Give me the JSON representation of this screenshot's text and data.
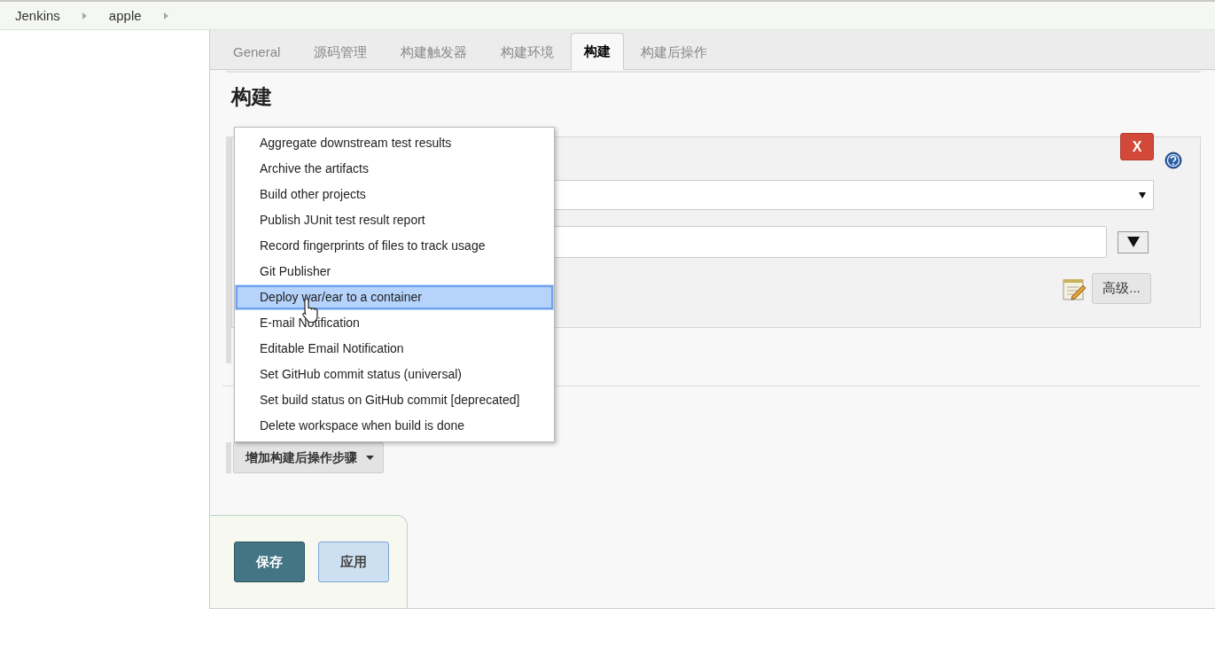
{
  "breadcrumbs": [
    {
      "label": "Jenkins"
    },
    {
      "label": "apple"
    }
  ],
  "tabs": [
    {
      "label": "General",
      "selected": false
    },
    {
      "label": "源码管理",
      "selected": false
    },
    {
      "label": "构建触发器",
      "selected": false
    },
    {
      "label": "构建环境",
      "selected": false
    },
    {
      "label": "构建",
      "selected": true
    },
    {
      "label": "构建后操作",
      "selected": false
    }
  ],
  "section_title": "构建",
  "build_step": {
    "delete_label": "X",
    "advanced_button": "高级..."
  },
  "add_post_build_button": "增加构建后操作步骤",
  "dropdown_menu": [
    {
      "label": "Aggregate downstream test results",
      "selected": false
    },
    {
      "label": "Archive the artifacts",
      "selected": false
    },
    {
      "label": "Build other projects",
      "selected": false
    },
    {
      "label": "Publish JUnit test result report",
      "selected": false
    },
    {
      "label": "Record fingerprints of files to track usage",
      "selected": false
    },
    {
      "label": "Git Publisher",
      "selected": false
    },
    {
      "label": "Deploy war/ear to a container",
      "selected": true
    },
    {
      "label": "E-mail Notification",
      "selected": false
    },
    {
      "label": "Editable Email Notification",
      "selected": false
    },
    {
      "label": "Set GitHub commit status (universal)",
      "selected": false
    },
    {
      "label": "Set build status on GitHub commit [deprecated]",
      "selected": false
    },
    {
      "label": "Delete workspace when build is done",
      "selected": false
    }
  ],
  "footer_buttons": [
    {
      "label": "保存",
      "kind": "primary"
    },
    {
      "label": "应用",
      "kind": "secondary"
    }
  ]
}
